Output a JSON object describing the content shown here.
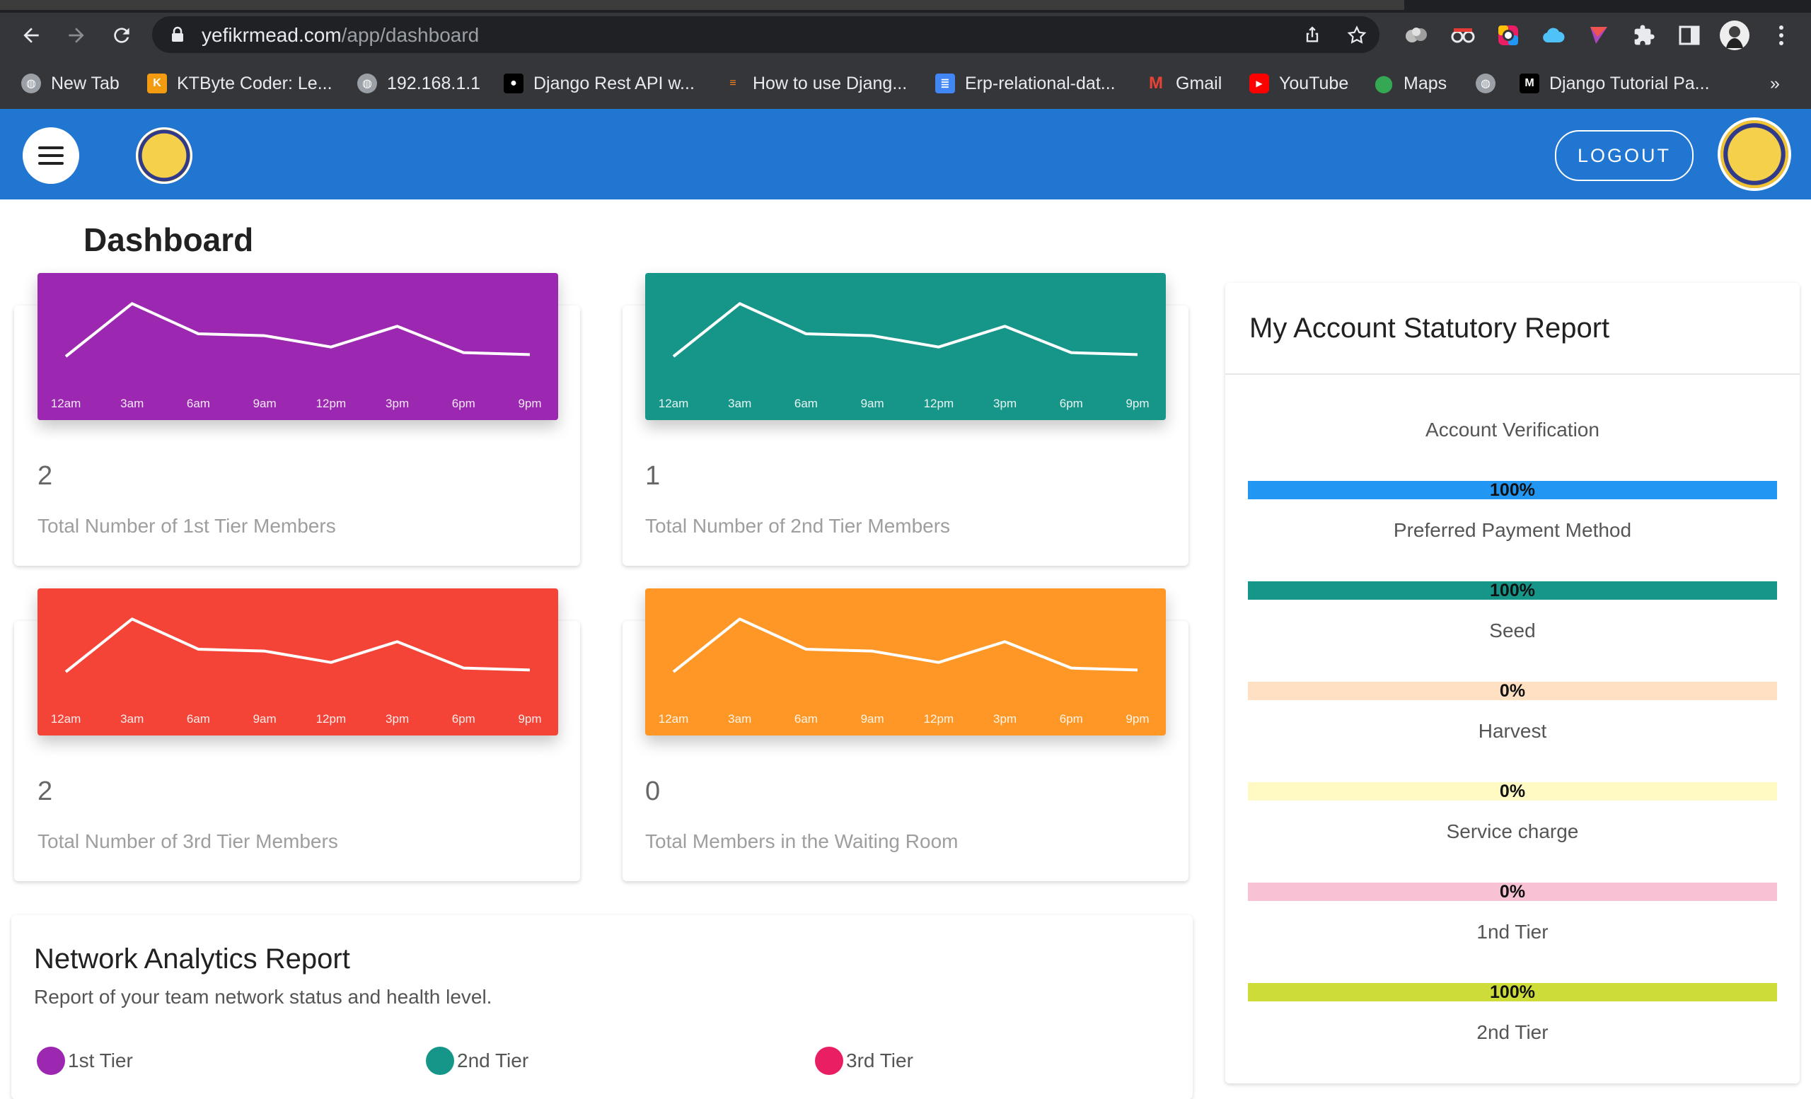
{
  "browser": {
    "url_host": "yefikrmead.com",
    "url_path": "/app/dashboard",
    "bookmarks": [
      {
        "label": "New Tab"
      },
      {
        "label": "KTByte Coder: Le..."
      },
      {
        "label": "192.168.1.1"
      },
      {
        "label": "Django Rest API w..."
      },
      {
        "label": "How to use Djang..."
      },
      {
        "label": "Erp-relational-dat..."
      },
      {
        "label": "Gmail"
      },
      {
        "label": "YouTube"
      },
      {
        "label": "Maps"
      },
      {
        "label": ""
      },
      {
        "label": "Django Tutorial Pa..."
      }
    ],
    "more_bookmarks": "»"
  },
  "appbar": {
    "logout_label": "LOGOUT"
  },
  "page": {
    "title": "Dashboard"
  },
  "stats": [
    {
      "value": "2",
      "label": "Total Number of 1st Tier Members",
      "color": "#9c27b0"
    },
    {
      "value": "1",
      "label": "Total Number of 2nd Tier Members",
      "color": "#169688"
    },
    {
      "value": "2",
      "label": "Total Number of 3rd Tier Members",
      "color": "#f34437"
    },
    {
      "value": "0",
      "label": "Total Members in the Waiting Room",
      "color": "#fe9725"
    }
  ],
  "chart_data": [
    {
      "type": "line",
      "x": [
        "12am",
        "3am",
        "6am",
        "9am",
        "12pm",
        "3pm",
        "6pm",
        "9pm"
      ],
      "series": [
        {
          "values": [
            12,
            40,
            24,
            23,
            17,
            28,
            14,
            13
          ]
        }
      ]
    },
    {
      "type": "line",
      "x": [
        "12am",
        "3am",
        "6am",
        "9am",
        "12pm",
        "3pm",
        "6pm",
        "9pm"
      ],
      "series": [
        {
          "values": [
            12,
            40,
            24,
            23,
            17,
            28,
            14,
            13
          ]
        }
      ]
    },
    {
      "type": "line",
      "x": [
        "12am",
        "3am",
        "6am",
        "9am",
        "12pm",
        "3pm",
        "6pm",
        "9pm"
      ],
      "series": [
        {
          "values": [
            12,
            40,
            24,
            23,
            17,
            28,
            14,
            13
          ]
        }
      ]
    },
    {
      "type": "line",
      "x": [
        "12am",
        "3am",
        "6am",
        "9am",
        "12pm",
        "3pm",
        "6pm",
        "9pm"
      ],
      "series": [
        {
          "values": [
            12,
            40,
            24,
            23,
            17,
            28,
            14,
            13
          ]
        }
      ]
    }
  ],
  "statutory": {
    "title": "My Account Statutory Report",
    "items": [
      {
        "label": "Account Verification",
        "percent": "100%",
        "value": 100,
        "color": "#2196f3",
        "track": "#bbdefb"
      },
      {
        "label": "Preferred Payment Method",
        "percent": "100%",
        "value": 100,
        "color": "#169688",
        "track": "#b2dfdb"
      },
      {
        "label": "Seed",
        "percent": "0%",
        "value": 0,
        "color": "#ff9800",
        "track": "#ffe0c2"
      },
      {
        "label": "Harvest",
        "percent": "0%",
        "value": 0,
        "color": "#ffeb3b",
        "track": "#fff9c4"
      },
      {
        "label": "Service charge",
        "percent": "0%",
        "value": 0,
        "color": "#e91e63",
        "track": "#f8c1d4"
      },
      {
        "label": "1nd Tier",
        "percent": "100%",
        "value": 100,
        "color": "#cddc39",
        "track": "#f0f4c3"
      },
      {
        "label": "2nd Tier",
        "percent": "",
        "value": null,
        "color": "",
        "track": ""
      }
    ]
  },
  "network": {
    "title": "Network Analytics Report",
    "subtitle": "Report of your team network status and health level.",
    "legend": [
      {
        "label": "1st Tier",
        "color": "#9c27b0"
      },
      {
        "label": "2nd Tier",
        "color": "#169688"
      },
      {
        "label": "3rd Tier",
        "color": "#e91e63"
      }
    ]
  }
}
